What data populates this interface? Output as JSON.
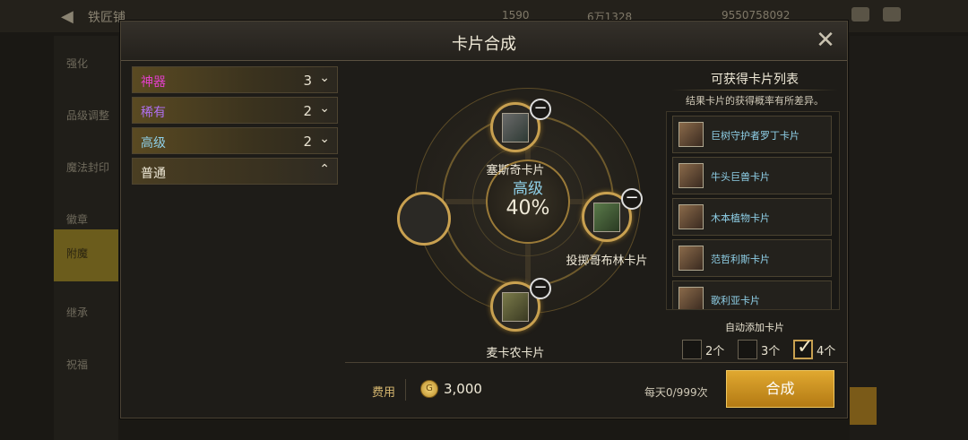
{
  "background": {
    "screen_title": "铁匠铺",
    "resources": [
      "1590",
      "6万1328",
      "9550758092"
    ],
    "side_items": [
      "强化",
      "品级调整",
      "魔法封印",
      "徽章",
      "附魔",
      "继承",
      "祝福"
    ],
    "active_side_item": "附魔"
  },
  "modal": {
    "title": "卡片合成",
    "close_icon": "close-icon"
  },
  "categories": [
    {
      "name": "神器",
      "count": "3",
      "color": "#e040c8",
      "expanded": false
    },
    {
      "name": "稀有",
      "count": "2",
      "color": "#b070f0",
      "expanded": false
    },
    {
      "name": "高级",
      "count": "2",
      "color": "#8fd0e8",
      "expanded": false
    },
    {
      "name": "普通",
      "count": "",
      "color": "#f0ead8",
      "expanded": true
    }
  ],
  "compose": {
    "grade": "高级",
    "probability": "40%",
    "slots": [
      {
        "position": "top",
        "label": "塞斯奇卡片"
      },
      {
        "position": "right",
        "label": "投掷哥布林卡片"
      },
      {
        "position": "bottom",
        "label": "麦卡农卡片"
      },
      {
        "position": "left",
        "label": ""
      }
    ]
  },
  "obtainable": {
    "title": "可获得卡片列表",
    "subtitle": "结果卡片的获得概率有所差异。",
    "items": [
      "巨树守护者罗丁卡片",
      "牛头巨兽卡片",
      "木本植物卡片",
      "范哲利斯卡片",
      "歌利亚卡片"
    ]
  },
  "auto_add": {
    "title": "自动添加卡片",
    "options": [
      {
        "label": "2个",
        "checked": false
      },
      {
        "label": "3个",
        "checked": false
      },
      {
        "label": "4个",
        "checked": true
      }
    ]
  },
  "footer": {
    "fee_label": "费用",
    "fee_value": "3,000",
    "daily_limit": "每天0/999次",
    "compose_button": "合成"
  }
}
